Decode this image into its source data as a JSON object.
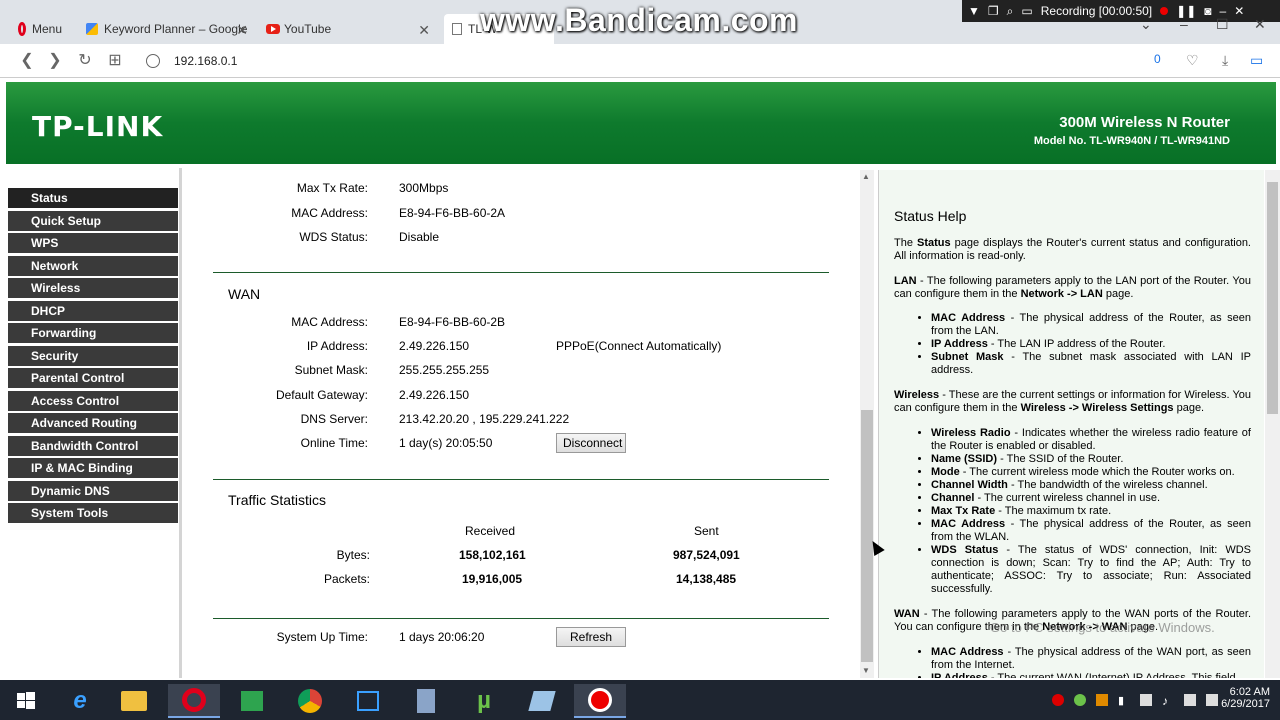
{
  "browser": {
    "menu_label": "Menu",
    "tabs": [
      {
        "label": "Keyword Planner – Google"
      },
      {
        "label": "YouTube"
      },
      {
        "label": "TL-W"
      }
    ],
    "url": "192.168.0.1",
    "badge": "0",
    "watermark": "www.Bandicam.com",
    "recording": "Recording [00:00:50]"
  },
  "header": {
    "logo": "TP-LINK",
    "product": "300M Wireless N Router",
    "model": "Model No. TL-WR940N / TL-WR941ND"
  },
  "sidebar": {
    "items": [
      {
        "label": "Status"
      },
      {
        "label": "Quick Setup"
      },
      {
        "label": "WPS"
      },
      {
        "label": "Network"
      },
      {
        "label": "Wireless"
      },
      {
        "label": "DHCP"
      },
      {
        "label": "Forwarding"
      },
      {
        "label": "Security"
      },
      {
        "label": "Parental Control"
      },
      {
        "label": "Access Control"
      },
      {
        "label": "Advanced Routing"
      },
      {
        "label": "Bandwidth Control"
      },
      {
        "label": "IP & MAC Binding"
      },
      {
        "label": "Dynamic DNS"
      },
      {
        "label": "System Tools"
      }
    ]
  },
  "wireless": {
    "max_tx_label": "Max Tx Rate:",
    "max_tx": "300Mbps",
    "mac_label": "MAC Address:",
    "mac": "E8-94-F6-BB-60-2A",
    "wds_label": "WDS Status:",
    "wds": "Disable"
  },
  "wan": {
    "title": "WAN",
    "mac_label": "MAC Address:",
    "mac": "E8-94-F6-BB-60-2B",
    "ip_label": "IP Address:",
    "ip": "2.49.226.150",
    "ip_mode": "PPPoE(Connect Automatically)",
    "subnet_label": "Subnet Mask:",
    "subnet": "255.255.255.255",
    "gateway_label": "Default Gateway:",
    "gateway": "2.49.226.150",
    "dns_label": "DNS Server:",
    "dns": "213.42.20.20 , 195.229.241.222",
    "online_label": "Online Time:",
    "online": "1 day(s) 20:05:50",
    "disconnect": "Disconnect"
  },
  "traffic": {
    "title": "Traffic Statistics",
    "received_label": "Received",
    "sent_label": "Sent",
    "bytes_label": "Bytes:",
    "bytes_received": "158,102,161",
    "bytes_sent": "987,524,091",
    "packets_label": "Packets:",
    "packets_received": "19,916,005",
    "packets_sent": "14,138,485"
  },
  "uptime": {
    "label": "System Up Time:",
    "value": "1 days 20:06:20",
    "refresh": "Refresh"
  },
  "help": {
    "title": "Status Help",
    "intro_pre": "The ",
    "intro_b": "Status",
    "intro_post": " page displays the Router's current status and configuration. All information is read-only.",
    "lan_b": "LAN",
    "lan_text": " - The following parameters apply to the LAN port of the Router. You can configure them in the ",
    "lan_link": "Network -> LAN",
    "lan_end": " page.",
    "lan_items": [
      {
        "b": "MAC Address",
        "t": " - The physical address of the Router, as seen from the LAN."
      },
      {
        "b": "IP Address",
        "t": " - The LAN IP address of the Router."
      },
      {
        "b": "Subnet Mask",
        "t": " - The subnet mask associated with LAN IP address."
      }
    ],
    "wireless_b": "Wireless",
    "wireless_text": " - These are the current settings or information for Wireless. You can configure them in the ",
    "wireless_link": "Wireless -> Wireless Settings",
    "wireless_end": " page.",
    "wireless_items": [
      {
        "b": "Wireless Radio",
        "t": " - Indicates whether the wireless radio feature of the Router is enabled or disabled."
      },
      {
        "b": "Name (SSID)",
        "t": " - The SSID of the Router."
      },
      {
        "b": "Mode",
        "t": " - The current wireless mode which the Router works on."
      },
      {
        "b": "Channel Width",
        "t": " - The bandwidth of the wireless channel."
      },
      {
        "b": "Channel",
        "t": " - The current wireless channel in use."
      },
      {
        "b": "Max Tx Rate",
        "t": " - The maximum tx rate."
      },
      {
        "b": "MAC Address",
        "t": " - The physical address of the Router, as seen from the WLAN."
      },
      {
        "b": "WDS Status",
        "t": " - The status of WDS' connection, Init: WDS connection is down; Scan: Try to find the AP; Auth: Try to authenticate; ASSOC: Try to associate; Run: Associated successfully."
      }
    ],
    "wan_b": "WAN",
    "wan_text": " - The following parameters apply to the WAN ports of the Router. You can configure them in the ",
    "wan_link": "Network -> WAN",
    "wan_end": " page.",
    "wan_items": [
      {
        "b": "MAC Address",
        "t": " - The physical address of the WAN port, as seen from the Internet."
      },
      {
        "b": "IP Address",
        "t": " - The current WAN (Internet) IP Address. This field"
      }
    ]
  },
  "os": {
    "activate": "Go to PC settings to activate Windows.",
    "time": "6:02 AM",
    "date": "6/29/2017"
  }
}
